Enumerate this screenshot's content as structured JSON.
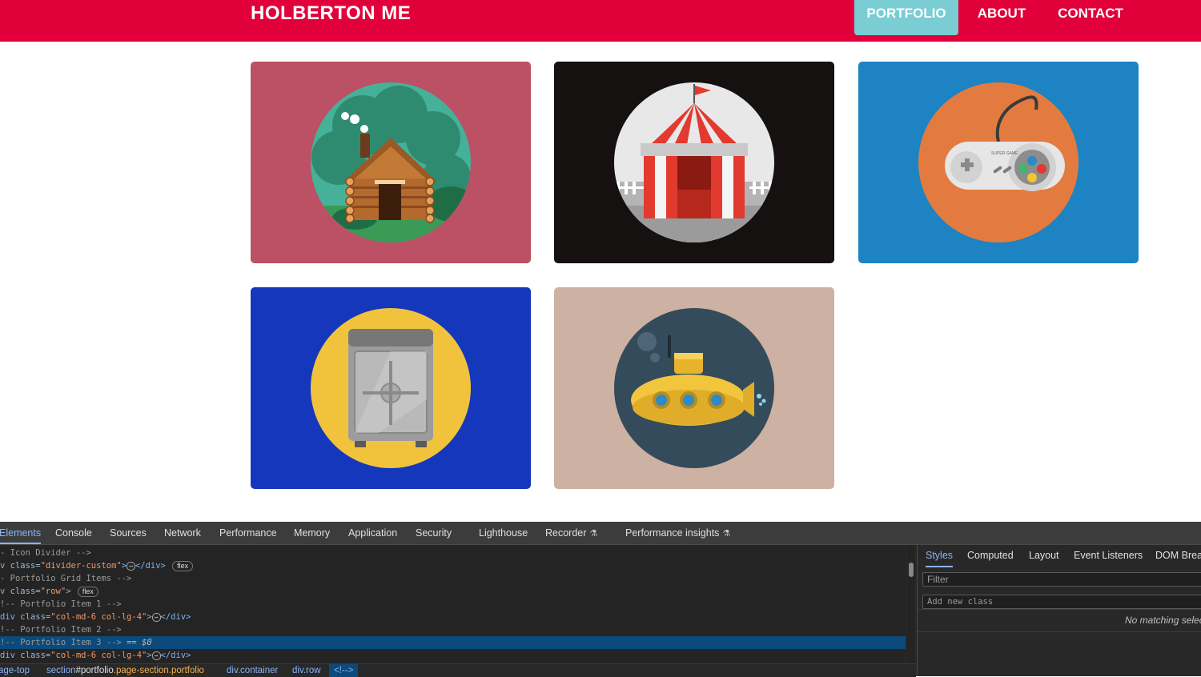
{
  "navbar": {
    "brand": "HOLBERTON ME",
    "items": [
      {
        "label": "PORTFOLIO",
        "active": true
      },
      {
        "label": "ABOUT",
        "active": false
      },
      {
        "label": "CONTACT",
        "active": false
      }
    ],
    "color": "#e1003a",
    "active_color": "#79cdd3"
  },
  "portfolio": {
    "items": [
      {
        "icon": "log-cabin-icon",
        "bg": "#bc5064"
      },
      {
        "icon": "circus-tent-icon",
        "bg": "#141110"
      },
      {
        "icon": "game-controller-icon",
        "bg": "#1d83c3",
        "controller_text": "SUPER GAME"
      },
      {
        "icon": "safe-icon",
        "bg": "#1437bb"
      },
      {
        "icon": "submarine-icon",
        "bg": "#cdb1a2"
      }
    ]
  },
  "devtools": {
    "tabs": [
      "Elements",
      "Console",
      "Sources",
      "Network",
      "Performance",
      "Memory",
      "Application",
      "Security",
      "Lighthouse",
      "Recorder",
      "Performance insights"
    ],
    "active_tab": "Elements",
    "dom_lines": [
      {
        "prefix": "- ",
        "comment": "Icon Divider -->"
      },
      {
        "prefix": "v ",
        "tag_open": "class=",
        "value": "\"divider-custom\"",
        "tag_close": "</div>",
        "pill": "flex"
      },
      {
        "prefix": "- ",
        "comment": "Portfolio Grid Items -->"
      },
      {
        "prefix": "v ",
        "tag_open": "class=",
        "value": "\"row\"",
        "pill": "flex"
      },
      {
        "prefix": "!-- ",
        "comment": "Portfolio Item 1 -->"
      },
      {
        "prefix": "div ",
        "tag_open": "class=",
        "value": "\"col-md-6 col-lg-4\"",
        "tag_close": "</div>"
      },
      {
        "prefix": "!-- ",
        "comment": "Portfolio Item 2 -->"
      },
      {
        "prefix": "!-- ",
        "comment": "Portfolio Item 3 -->",
        "marker": "== $0",
        "selected": true
      },
      {
        "prefix": "div ",
        "tag_open": "class=",
        "value": "\"col-md-6 col-lg-4\"",
        "tag_close": "</div>"
      }
    ],
    "breadcrumb": [
      {
        "label": "age-top"
      },
      {
        "label": "section",
        "id": "#portfolio",
        "cls": ".page-section.portfolio"
      },
      {
        "label": "div.container"
      },
      {
        "label": "div.row"
      },
      {
        "label": "<!-->"
      }
    ],
    "side_tabs": [
      "Styles",
      "Computed",
      "Layout",
      "Event Listeners",
      "DOM Breal"
    ],
    "active_side_tab": "Styles",
    "filter_placeholder": "Filter",
    "class_placeholder": "Add new class",
    "no_match": "No matching selec"
  }
}
